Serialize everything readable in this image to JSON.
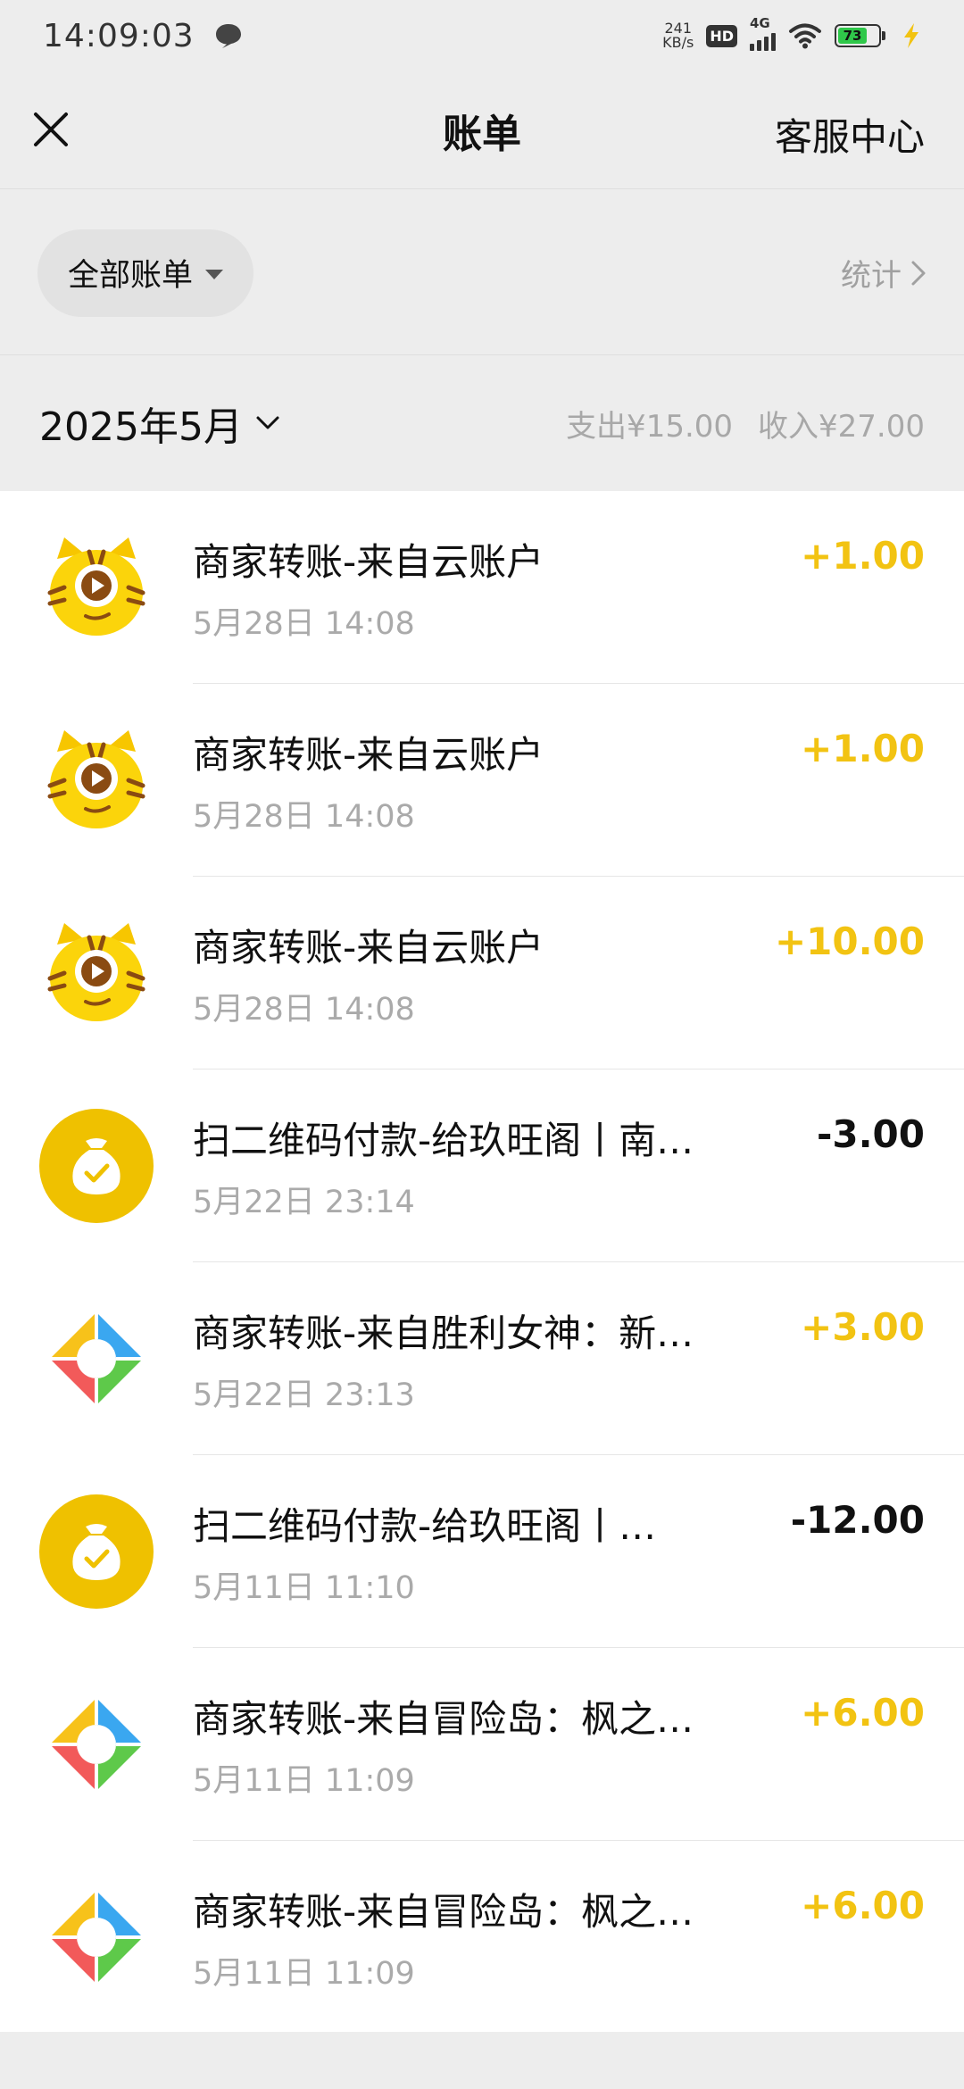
{
  "status_bar": {
    "time": "14:09:03",
    "net_speed_value": "241",
    "net_speed_unit": "KB/s",
    "hd_label": "HD",
    "signal_label": "4G",
    "battery_level": "73",
    "chat_icon": "chat-bubble-icon",
    "wifi_icon": "wifi-icon",
    "charging_icon": "bolt-icon"
  },
  "nav": {
    "close_icon": "close-icon",
    "title": "账单",
    "right_label": "客服中心"
  },
  "filter": {
    "selected": "全部账单",
    "stats_label": "统计"
  },
  "months": [
    {
      "label": "2025年5月",
      "expense_summary": "支出¥15.00",
      "income_summary": "收入¥27.00",
      "transactions": [
        {
          "icon": "tiger-mascot-icon",
          "title": "商家转账-来自云账户",
          "time": "5月28日 14:08",
          "amount": "+1.00",
          "type": "income"
        },
        {
          "icon": "tiger-mascot-icon",
          "title": "商家转账-来自云账户",
          "time": "5月28日 14:08",
          "amount": "+1.00",
          "type": "income"
        },
        {
          "icon": "tiger-mascot-icon",
          "title": "商家转账-来自云账户",
          "time": "5月28日 14:08",
          "amount": "+10.00",
          "type": "income"
        },
        {
          "icon": "money-bag-icon",
          "title": "扫二维码付款-给玖旺阁丨南…",
          "time": "5月22日 23:14",
          "amount": "-3.00",
          "type": "expense"
        },
        {
          "icon": "game-platform-icon",
          "title": "商家转账-来自胜利女神：新…",
          "time": "5月22日 23:13",
          "amount": "+3.00",
          "type": "income"
        },
        {
          "icon": "money-bag-icon",
          "title": "扫二维码付款-给玖旺阁丨…",
          "time": "5月11日 11:10",
          "amount": "-12.00",
          "type": "expense"
        },
        {
          "icon": "game-platform-icon",
          "title": "商家转账-来自冒险岛：枫之…",
          "time": "5月11日 11:09",
          "amount": "+6.00",
          "type": "income"
        },
        {
          "icon": "game-platform-icon",
          "title": "商家转账-来自冒险岛：枫之…",
          "time": "5月11日 11:09",
          "amount": "+6.00",
          "type": "income"
        }
      ]
    }
  ],
  "colors": {
    "income": "#f2c312",
    "expense": "#111111",
    "background": "#ededed"
  }
}
